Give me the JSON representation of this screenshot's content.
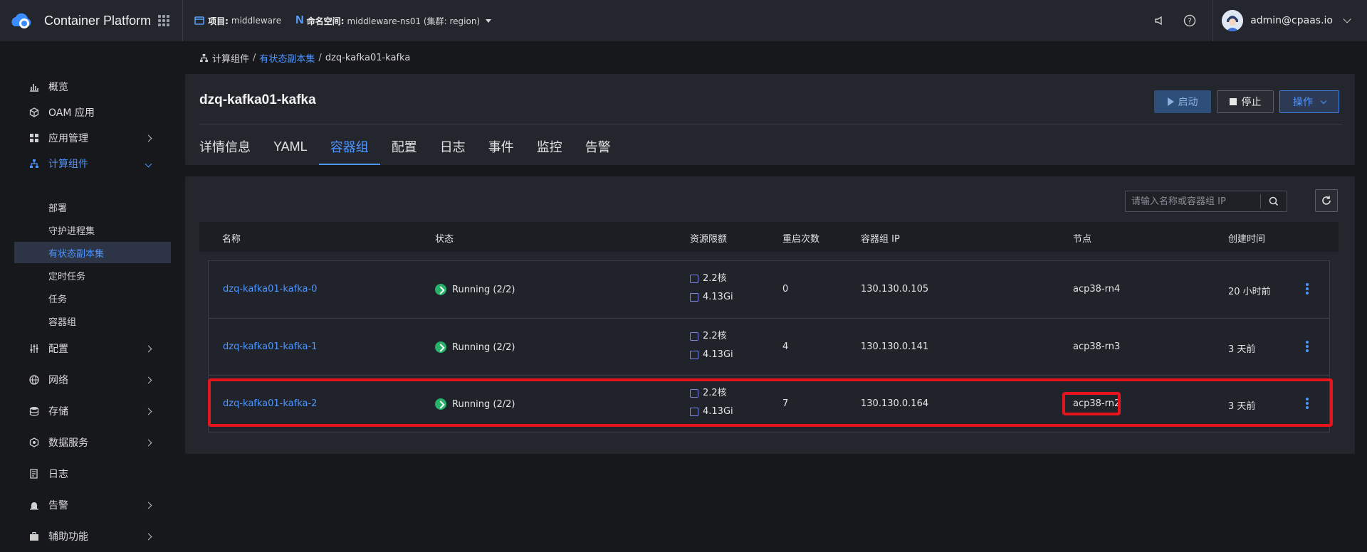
{
  "app": {
    "title": "Container Platform"
  },
  "context": {
    "project_label": "项目:",
    "project_value": "middleware",
    "namespace_label": "命名空间:",
    "namespace_value": "middleware-ns01 (集群: region)"
  },
  "user": {
    "name": "admin@cpaas.io"
  },
  "sidebar": {
    "items": [
      {
        "label": "概览",
        "icon": "bar-chart-icon"
      },
      {
        "label": "OAM 应用",
        "icon": "cube-icon"
      },
      {
        "label": "应用管理",
        "icon": "apps-icon"
      },
      {
        "label": "计算组件",
        "icon": "hierarchy-icon"
      },
      {
        "label": "配置",
        "icon": "sliders-icon"
      },
      {
        "label": "网络",
        "icon": "globe-icon"
      },
      {
        "label": "存储",
        "icon": "database-icon"
      },
      {
        "label": "数据服务",
        "icon": "hexagon-icon"
      },
      {
        "label": "日志",
        "icon": "log-icon"
      },
      {
        "label": "告警",
        "icon": "alarm-icon"
      },
      {
        "label": "辅助功能",
        "icon": "toolbox-icon"
      }
    ],
    "compute_children": [
      "部署",
      "守护进程集",
      "有状态副本集",
      "定时任务",
      "任务",
      "容器组"
    ]
  },
  "breadcrumb": {
    "root": "计算组件",
    "parent": "有状态副本集",
    "current": "dzq-kafka01-kafka"
  },
  "resource": {
    "title": "dzq-kafka01-kafka"
  },
  "actions": {
    "start": "启动",
    "stop": "停止",
    "ops": "操作"
  },
  "tabs": [
    "详情信息",
    "YAML",
    "容器组",
    "配置",
    "日志",
    "事件",
    "监控",
    "告警"
  ],
  "search": {
    "placeholder": "请输入名称或容器组 IP"
  },
  "table": {
    "headers": [
      "名称",
      "状态",
      "资源限额",
      "重启次数",
      "容器组 IP",
      "节点",
      "创建时间"
    ],
    "rows": [
      {
        "name": "dzq-kafka01-kafka-0",
        "status": "Running (2/2)",
        "cpu": "2.2核",
        "mem": "4.13Gi",
        "restarts": "0",
        "ip": "130.130.0.105",
        "node": "acp38-rn4",
        "created": "20 小时前"
      },
      {
        "name": "dzq-kafka01-kafka-1",
        "status": "Running (2/2)",
        "cpu": "2.2核",
        "mem": "4.13Gi",
        "restarts": "4",
        "ip": "130.130.0.141",
        "node": "acp38-rn3",
        "created": "3 天前"
      },
      {
        "name": "dzq-kafka01-kafka-2",
        "status": "Running (2/2)",
        "cpu": "2.2核",
        "mem": "4.13Gi",
        "restarts": "7",
        "ip": "130.130.0.164",
        "node": "acp38-rn2",
        "created": "3 天前"
      }
    ]
  },
  "colors": {
    "accent": "#4f95ff",
    "running": "#26b26a",
    "highlight": "#e8141c"
  }
}
